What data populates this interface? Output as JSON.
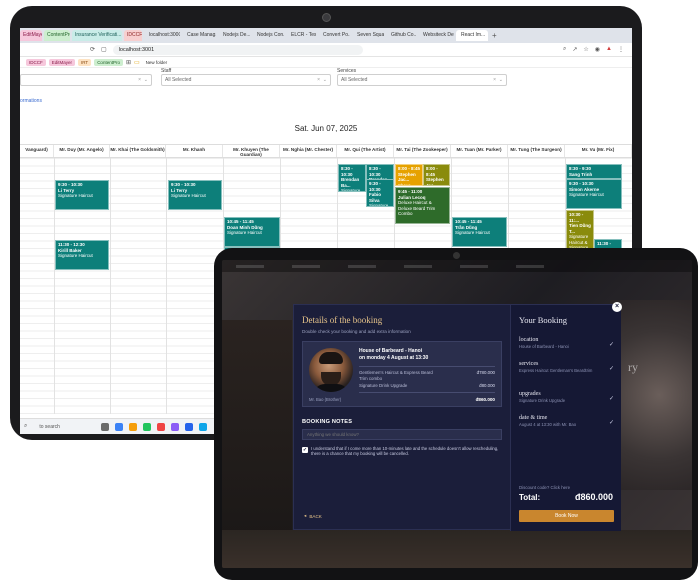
{
  "browser": {
    "tabs": [
      {
        "label": "EditMayer",
        "color": "pink"
      },
      {
        "label": "ContentPro",
        "color": "green"
      },
      {
        "label": "Insurance Verificati...",
        "color": "teal"
      },
      {
        "label": "IDCCF",
        "color": "red"
      },
      {
        "label": "localhost:3000",
        "color": "plain"
      },
      {
        "label": "Case Manag...",
        "color": "plain"
      },
      {
        "label": "Nodejs De...",
        "color": "plain"
      },
      {
        "label": "Nodejs Con...",
        "color": "plain"
      },
      {
        "label": "ELCR - Test",
        "color": "plain"
      },
      {
        "label": "Convert Po...",
        "color": "plain"
      },
      {
        "label": "Seven Squa...",
        "color": "plain"
      },
      {
        "label": "Github Co...",
        "color": "plain"
      },
      {
        "label": "Websiteck De...",
        "color": "plain"
      },
      {
        "label": "React Im...",
        "color": "active"
      }
    ],
    "url": "localhost:3001",
    "bookmarks": [
      {
        "label": "IDCCF",
        "color": "pink"
      },
      {
        "label": "EditMayer",
        "color": "pink"
      },
      {
        "label": "IRT",
        "color": "orange"
      },
      {
        "label": "ContentPro",
        "color": "green"
      },
      {
        "label": "New folder",
        "color": "plain"
      }
    ]
  },
  "filters": {
    "staff_label": "Staff",
    "staff_value": "All Selected",
    "services_label": "Services",
    "services_value": "All Selected",
    "info_link": "ormations"
  },
  "calendar": {
    "date": "Sat. Jun 07, 2025",
    "columns": [
      "Vanguard)",
      "Mr. Duy (Mr. Angelo)",
      "Mr. Khai (The Goldsmith)",
      "Mr. Khanh",
      "Mr. Khuyen (The Guardian)",
      "Mr. Nghia (Mr. Chester)",
      "Mr. Qui (The Artist)",
      "Mr. Tai (The Zookeeper)",
      "Mr. Tuan (Mr. Parker)",
      "Mr. Tung (The Surgeon)",
      "Mr. Vu (Mr. Fix)"
    ],
    "appointments": [
      {
        "time": "9:30 - 10:30",
        "name": "Li Terry",
        "service": "Signature Haircut",
        "color": "teal"
      },
      {
        "time": "11:30 - 12:30",
        "name": "Kirill Baker",
        "service": "Signature Haircut",
        "color": "teal"
      },
      {
        "time": "9:30 - 10:30",
        "name": "Li Terry",
        "service": "Signature Haircut",
        "color": "teal"
      },
      {
        "time": "10:45 - 11:45",
        "name": "Doan Minh Dũng",
        "service": "Signature Haircut",
        "color": "teal"
      },
      {
        "time": "11:45 - 12:45",
        "name": "",
        "service": "",
        "color": "teal"
      },
      {
        "time": "8:30 - 10:30",
        "name": "Brendan Ba...",
        "service": "Signature Haircut",
        "color": "teal"
      },
      {
        "time": "8:30 - 10:30",
        "name": "Brendan Ba...",
        "service": "",
        "color": "teal"
      },
      {
        "time": "9:30 - 10:30",
        "name": "Fabio Silva",
        "service": "Signature Haircut",
        "color": "teal"
      },
      {
        "time": "8:00 - 8:45",
        "name": "Stephen Jac...",
        "service": "Shave",
        "color": "orange"
      },
      {
        "time": "8:00 - 8:45",
        "name": "Stephen Jac...",
        "service": "Signature",
        "color": "olive"
      },
      {
        "time": "9:45 - 11:00",
        "name": "Julian Lecoq",
        "service": "Deluxe Haircut & Deluxe Beard Trim Combo",
        "color": "green"
      },
      {
        "time": "10:45 - 11:45",
        "name": "Trần Dũng",
        "service": "Signature Haircut",
        "color": "teal"
      },
      {
        "time": "8:30 - 9:30",
        "name": "Sang Trinh",
        "service": "",
        "color": "teal"
      },
      {
        "time": "9:30 - 10:30",
        "name": "Simon Akerne",
        "service": "Signature Haircut",
        "color": "teal"
      },
      {
        "time": "10:30 - 11:...",
        "name": "Tien Dũng T...",
        "service": "Signature Haircut & Signature Shave & Signature Drink",
        "color": "olive"
      },
      {
        "time": "11:30 - 12:...",
        "name": "Tuấn Anh F...",
        "service": "",
        "color": "teal"
      }
    ]
  },
  "taskbar": {
    "search_placeholder": "to search"
  },
  "booking": {
    "title": "Details of the booking",
    "subtitle": "Double check your booking and add extra information",
    "shop_name": "House of Barbeard - Hanoi",
    "date_line": "on monday 4 August at 13:30",
    "services": [
      {
        "name": "Gentlemen's Haircut & Express Beard Trim combo",
        "price": "đ780.000"
      },
      {
        "name": "Signature Drink Upgrade",
        "price": "đ80.000"
      }
    ],
    "staff": "Mr. Bao (Brother)",
    "card_total": "đ860.000",
    "notes_title": "BOOKING NOTES",
    "notes_placeholder": "Anything we should know?",
    "agree_text": "I understand that if I come more than 10-minutes late and the schedule doesn't allow rescheduling, there is a chance that my booking will be cancelled.",
    "back_label": "BACK",
    "close_label": "×"
  },
  "summary": {
    "title": "Your Booking",
    "items": [
      {
        "label": "location",
        "value": "House of Barbeard - Hanoi"
      },
      {
        "label": "services",
        "value": "Express Haircut Gentleman's Beardtrim"
      },
      {
        "label": "upgrades",
        "value": "Signature Drink Upgrade"
      },
      {
        "label": "date & time",
        "value": "August 4 at 13:30 with Mr. Bao"
      }
    ],
    "discount_text": "Discount code? Click here",
    "total_label": "Total:",
    "total_value": "đ860.000",
    "book_label": "Book Now"
  },
  "background": {
    "partial_text": "ry"
  },
  "colors": {
    "accent_gold": "#e7c48a",
    "book_button": "#c9862e",
    "modal_bg": "#1b1e3a",
    "appointment_teal": "#0d7f7a"
  }
}
